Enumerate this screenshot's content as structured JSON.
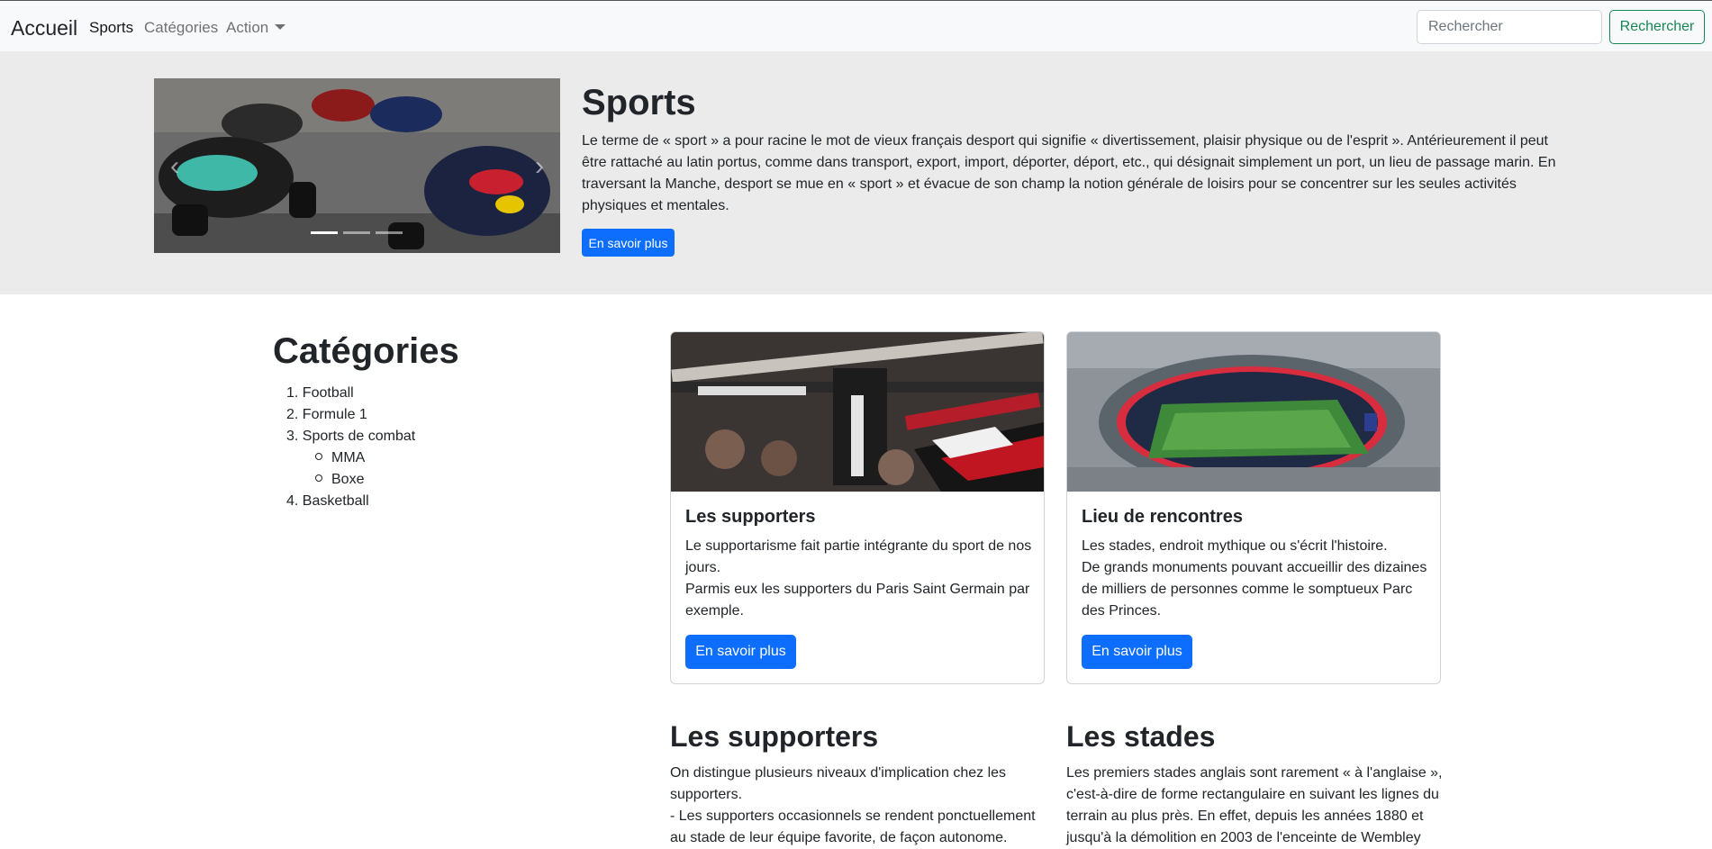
{
  "navbar": {
    "brand": "Accueil",
    "links": [
      "Sports",
      "Catégories",
      "Action"
    ],
    "search_placeholder": "Rechercher",
    "search_button": "Rechercher"
  },
  "hero": {
    "title": "Sports",
    "text": "Le terme de « sport » a pour racine le mot de vieux français desport qui signifie « divertissement, plaisir physique ou de l'esprit ». Antérieurement il peut être rattaché au latin portus, comme dans transport, export, import, déporter, déport, etc., qui désignait simplement un port, un lieu de passage marin. En traversant la Manche, desport se mue en « sport » et évacue de son champ la notion générale de loisirs pour se concentrer sur les seules activités physiques et mentales.",
    "button": "En savoir plus",
    "carousel": {
      "active_slide": 1,
      "slide_count": 3,
      "prev_icon": "chevron-left-icon",
      "next_icon": "chevron-right-icon"
    }
  },
  "categories": {
    "title": "Catégories",
    "items": [
      {
        "num": "1.",
        "label": "Football"
      },
      {
        "num": "2.",
        "label": "Formule 1"
      },
      {
        "num": "3.",
        "label": "Sports de combat",
        "sub": [
          "MMA",
          "Boxe"
        ]
      },
      {
        "num": "4.",
        "label": "Basketball"
      }
    ]
  },
  "cards": [
    {
      "title": "Les supporters",
      "text_lines": [
        "Le supportarisme fait partie intégrante du sport de nos jours.",
        "Parmis eux les supporters du Paris Saint Germain par exemple."
      ],
      "button": "En savoir plus"
    },
    {
      "title": "Lieu de rencontres",
      "text_lines": [
        "Les stades, endroit mythique ou s'écrit l'histoire.",
        "De grands monuments pouvant accueillir des dizaines de milliers de personnes comme le somptueux Parc des Princes."
      ],
      "button": "En savoir plus"
    }
  ],
  "sections": [
    {
      "title": "Les supporters",
      "text_lines": [
        "On distingue plusieurs niveaux d'implication chez les supporters.",
        "- Les supporters occasionnels se rendent ponctuellement au stade de leur équipe favorite, de façon autonome."
      ]
    },
    {
      "title": "Les stades",
      "text_lines": [
        "Les premiers stades anglais sont rarement « à l'anglaise », c'est-à-dire de forme rectangulaire en suivant les lignes du terrain au plus près. En effet, depuis les années 1880 et jusqu'à la démolition en 2003 de l'enceinte de Wembley"
      ]
    }
  ],
  "colors": {
    "primary": "#0d6efd",
    "success": "#198754",
    "hero_bg": "#ebebeb",
    "navbar_bg": "#f8f9fa"
  }
}
